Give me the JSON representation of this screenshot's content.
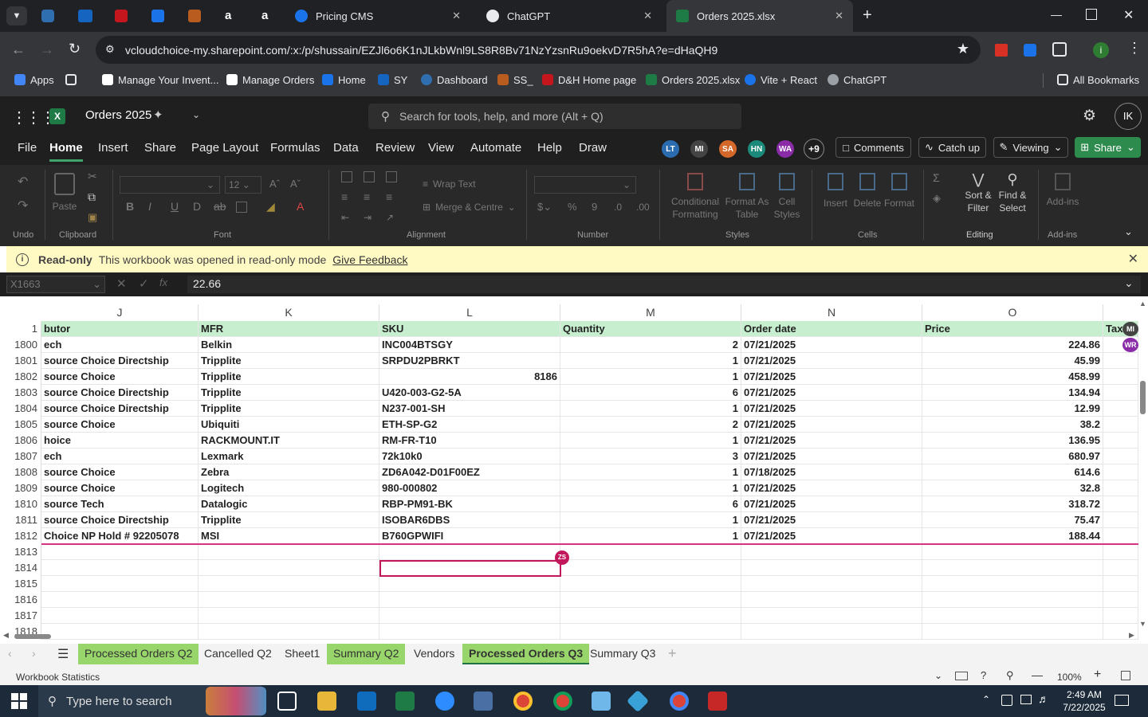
{
  "browser": {
    "tabs": [
      {
        "label": "Pricing CMS",
        "color": "#1a73e8"
      },
      {
        "label": "ChatGPT",
        "color": "#10a37f"
      },
      {
        "label": "Orders 2025.xlsx",
        "color": "#1e7b45"
      }
    ],
    "url": "vcloudchoice-my.sharepoint.com/:x:/p/shussain/EZJl6o6K1nJLkbWnl9LS8R8Bv71NzYzsnRu9oekvD7R5hA?e=dHaQH9",
    "bookmarks": [
      "Apps",
      "Manage Your Invent...",
      "Manage Orders",
      "Home",
      "SY",
      "Dashboard",
      "SS_",
      "D&H Home page",
      "Orders 2025.xlsx",
      "Vite + React",
      "ChatGPT"
    ],
    "all_bookmarks": "All Bookmarks"
  },
  "excel": {
    "title": "Orders 2025",
    "search_placeholder": "Search for tools, help, and more (Alt + Q)",
    "user_initials": "IK",
    "menus": [
      "File",
      "Home",
      "Insert",
      "Share",
      "Page Layout",
      "Formulas",
      "Data",
      "Review",
      "View",
      "Automate",
      "Help",
      "Draw"
    ],
    "active_menu": "Home",
    "collaborators": [
      {
        "initials": "LT",
        "color": "#2b6cb0"
      },
      {
        "initials": "MI",
        "color": "#444444"
      },
      {
        "initials": "SA",
        "color": "#d4682a"
      },
      {
        "initials": "HN",
        "color": "#1b8a7a"
      },
      {
        "initials": "WA",
        "color": "#8a2ca8"
      }
    ],
    "more_collaborators": "+9",
    "comments_label": "Comments",
    "catchup_label": "Catch up",
    "viewing_label": "Viewing",
    "share_label": "Share",
    "ribbon": {
      "undo": "Undo",
      "paste": "Paste",
      "clipboard": "Clipboard",
      "font_size": "12",
      "font": "Font",
      "wrap_text": "Wrap Text",
      "merge_centre": "Merge & Centre",
      "alignment": "Alignment",
      "number": "Number",
      "conditional_formatting": "Conditional Formatting",
      "format_as_table": "Format As Table",
      "cell_styles": "Cell Styles",
      "styles": "Styles",
      "insert": "Insert",
      "delete": "Delete",
      "format": "Format",
      "cells": "Cells",
      "sort_filter": "Sort & Filter",
      "find_select": "Find & Select",
      "editing": "Editing",
      "addins_btn": "Add-ins",
      "addins": "Add-ins"
    },
    "info_bar": {
      "title": "Read-only",
      "message": "This workbook was opened in read-only mode",
      "link": "Give Feedback"
    },
    "name_box": "X1663",
    "formula_value": "22.66",
    "columns": [
      "J",
      "K",
      "L",
      "M",
      "N",
      "O"
    ],
    "header_row": {
      "row": "1",
      "cells": [
        "butor",
        "MFR",
        "SKU",
        "Quantity",
        "Order date",
        "Price",
        "Tax"
      ]
    },
    "rows": [
      {
        "n": "1800",
        "c": [
          "ech",
          "Belkin",
          "INC004BTSGY",
          "2",
          "07/21/2025",
          "224.86"
        ]
      },
      {
        "n": "1801",
        "c": [
          "source Choice Directship",
          "Tripplite",
          "SRPDU2PBRKT",
          "1",
          "07/21/2025",
          "45.99"
        ]
      },
      {
        "n": "1802",
        "c": [
          "source Choice",
          "Tripplite",
          "8186",
          "1",
          "07/21/2025",
          "458.99"
        ]
      },
      {
        "n": "1803",
        "c": [
          "source Choice Directship",
          "Tripplite",
          "U420-003-G2-5A",
          "6",
          "07/21/2025",
          "134.94"
        ]
      },
      {
        "n": "1804",
        "c": [
          "source Choice Directship",
          "Tripplite",
          "N237-001-SH",
          "1",
          "07/21/2025",
          "12.99"
        ]
      },
      {
        "n": "1805",
        "c": [
          "source Choice",
          "Ubiquiti",
          "ETH-SP-G2",
          "2",
          "07/21/2025",
          "38.2"
        ]
      },
      {
        "n": "1806",
        "c": [
          "hoice",
          "RACKMOUNT.IT",
          "RM-FR-T10",
          "1",
          "07/21/2025",
          "136.95"
        ]
      },
      {
        "n": "1807",
        "c": [
          "ech",
          "Lexmark",
          "72k10k0",
          "3",
          "07/21/2025",
          "680.97"
        ]
      },
      {
        "n": "1808",
        "c": [
          "source Choice",
          "Zebra",
          "ZD6A042-D01F00EZ",
          "1",
          "07/18/2025",
          "614.6"
        ]
      },
      {
        "n": "1809",
        "c": [
          "source Choice",
          "Logitech",
          "980-000802",
          "1",
          "07/21/2025",
          "32.8"
        ]
      },
      {
        "n": "1810",
        "c": [
          "source Tech",
          "Datalogic",
          "RBP-PM91-BK",
          "6",
          "07/21/2025",
          "318.72"
        ]
      },
      {
        "n": "1811",
        "c": [
          "source Choice Directship",
          "Tripplite",
          "ISOBAR6DBS",
          "1",
          "07/21/2025",
          "75.47"
        ]
      },
      {
        "n": "1812",
        "c": [
          "Choice NP Hold # 92205078",
          "MSI",
          "B760GPWIFI",
          "1",
          "07/21/2025",
          "188.44"
        ]
      }
    ],
    "empty_rows": [
      "1813",
      "1814",
      "1815",
      "1816",
      "1817",
      "1818"
    ],
    "cursor_tag": "ZS",
    "cell_tags": [
      "MI",
      "WR"
    ],
    "sheets": [
      "Processed Orders Q2",
      "Cancelled Q2",
      "Sheet1",
      "Summary Q2",
      "Vendors",
      "Processed Orders Q3",
      "Summary Q3"
    ],
    "active_sheet": "Processed Orders Q3",
    "status_left": "Workbook Statistics",
    "zoom": "100%"
  },
  "taskbar": {
    "search_placeholder": "Type here to search",
    "time": "2:49 AM",
    "date": "7/22/2025"
  }
}
